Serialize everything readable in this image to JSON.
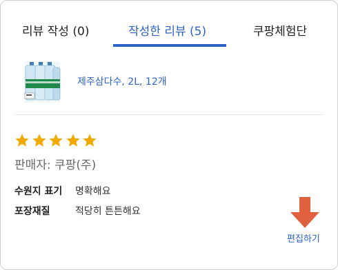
{
  "tabs": [
    {
      "label": "리뷰 작성 (0)",
      "active": false
    },
    {
      "label": "작성한 리뷰 (5)",
      "active": true
    },
    {
      "label": "쿠팡체험단",
      "active": false
    }
  ],
  "product": {
    "name": "제주삼다수, 2L, 12개",
    "image_icon": "water-bottle-pack"
  },
  "review": {
    "rating": 5,
    "rating_max": 5,
    "seller": "판매자: 쿠팡(주)",
    "details": [
      {
        "label": "수원지 표기",
        "value": "명확해요"
      },
      {
        "label": "포장재질",
        "value": "적당히 튼튼해요"
      }
    ],
    "edit_label": "편집하기"
  },
  "colors": {
    "accent": "#2d63c8",
    "star": "#f2a900",
    "arrow": "#e0613f"
  }
}
